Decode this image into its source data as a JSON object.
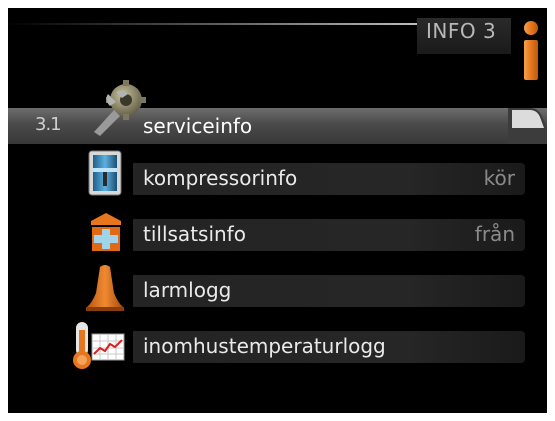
{
  "header": {
    "title": "INFO 3",
    "icon": "info-icon"
  },
  "menu": {
    "items": [
      {
        "number": "3.1",
        "label": "serviceinfo",
        "value": "",
        "icon": "wrench-gear-icon",
        "selected": true
      },
      {
        "number": "",
        "label": "kompressorinfo",
        "value": "kör",
        "icon": "compressor-icon",
        "selected": false
      },
      {
        "number": "",
        "label": "tillsatsinfo",
        "value": "från",
        "icon": "additional-heat-icon",
        "selected": false
      },
      {
        "number": "",
        "label": "larmlogg",
        "value": "",
        "icon": "alarm-bell-icon",
        "selected": false
      },
      {
        "number": "",
        "label": "inomhustemperaturlogg",
        "value": "",
        "icon": "thermometer-chart-icon",
        "selected": false
      }
    ]
  },
  "colors": {
    "accent": "#e8761e",
    "background": "#000000",
    "row": "#252525",
    "text": "#eaeaea",
    "muted": "#8a8a8a"
  }
}
